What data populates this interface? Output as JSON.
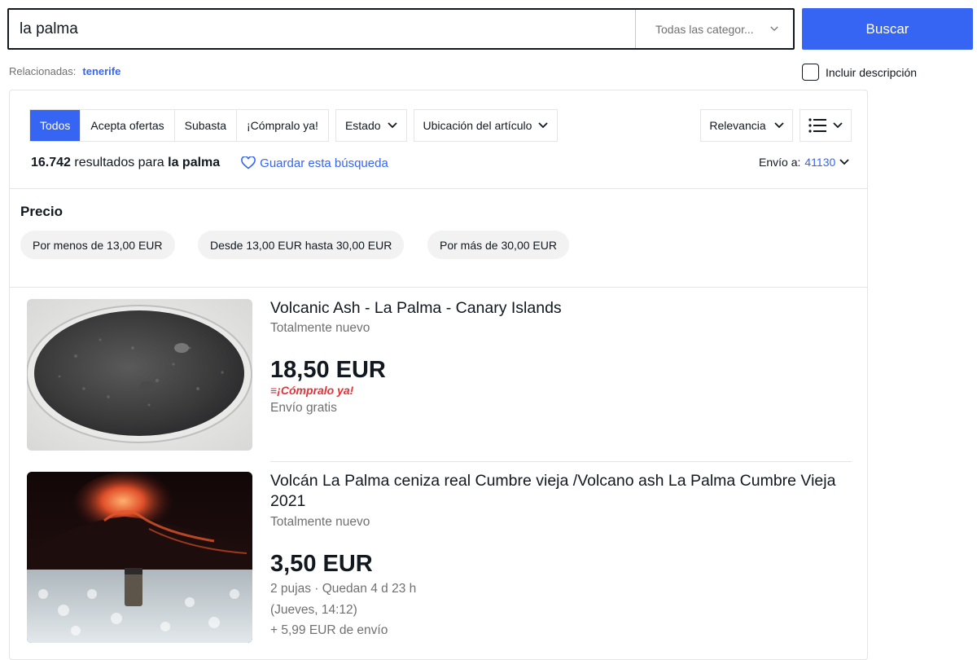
{
  "search": {
    "query": "la palma",
    "category": "Todas las categor...",
    "button": "Buscar"
  },
  "related": {
    "label": "Relacionadas:",
    "link": "tenerife"
  },
  "include_description": {
    "label": "Incluir descripción",
    "checked": false
  },
  "filters": {
    "tabs": [
      "Todos",
      "Acepta ofertas",
      "Subasta",
      "¡Cómpralo ya!"
    ],
    "active_tab": "Todos",
    "estado": "Estado",
    "ubicacion": "Ubicación del artículo",
    "sort": "Relevancia"
  },
  "results": {
    "count": "16.742",
    "text": "resultados para",
    "query": "la palma",
    "save": "Guardar esta búsqueda",
    "ship_label": "Envío a:",
    "zip": "41130"
  },
  "price": {
    "title": "Precio",
    "chips": [
      "Por menos de 13,00 EUR",
      "Desde 13,00 EUR hasta 30,00 EUR",
      "Por más de 30,00 EUR"
    ]
  },
  "items": [
    {
      "title": "Volcanic Ash - La Palma - Canary Islands",
      "condition": "Totalmente nuevo",
      "price": "18,50 EUR",
      "badge": "¡Cómpralo ya!",
      "shipping": "Envío gratis"
    },
    {
      "title": "Volcán La Palma ceniza real Cumbre vieja /Volcano ash La Palma Cumbre Vieja 2021",
      "condition": "Totalmente nuevo",
      "price": "3,50 EUR",
      "bids": "2 pujas · Quedan 4 d 23 h",
      "end": "(Jueves, 14:12)",
      "shipping": "+ 5,99 EUR de envío"
    }
  ],
  "colors": {
    "accent": "#3665f3",
    "text": "#111820",
    "muted": "#707070",
    "bin_red": "#e53238"
  }
}
